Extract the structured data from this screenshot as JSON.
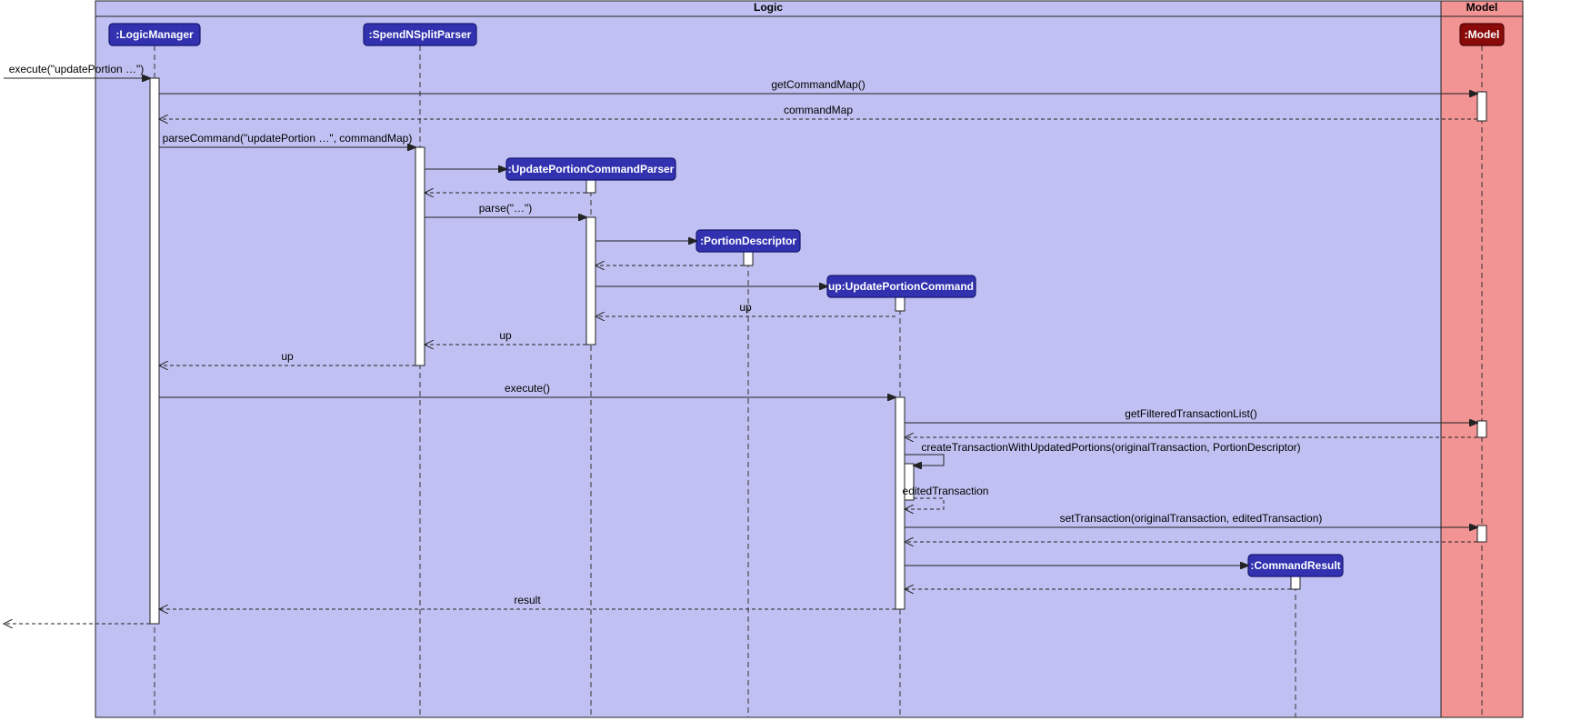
{
  "frames": {
    "logic_title": "Logic",
    "model_title": "Model"
  },
  "participants": {
    "logicManager": ":LogicManager",
    "spendNSplitParser": ":SpendNSplitParser",
    "updatePortionCommandParser": ":UpdatePortionCommandParser",
    "portionDescriptor": ":PortionDescriptor",
    "updatePortionCommand": "up:UpdatePortionCommand",
    "commandResult": ":CommandResult",
    "model": ":Model"
  },
  "messages": {
    "execute_in": "execute(\"updatePortion …\")",
    "getCommandMap": "getCommandMap()",
    "commandMap": "commandMap",
    "parseCommand": "parseCommand(\"updatePortion …\", commandMap)",
    "parse": "parse(\"…\")",
    "up1": "up",
    "up2": "up",
    "up3": "up",
    "executeCmd": "execute()",
    "getFilteredTransactionList": "getFilteredTransactionList()",
    "createTransactionWithUpdatedPortions": "createTransactionWithUpdatedPortions(originalTransaction, PortionDescriptor)",
    "editedTransaction": "editedTransaction",
    "setTransaction": "setTransaction(originalTransaction, editedTransaction)",
    "result": "result"
  }
}
